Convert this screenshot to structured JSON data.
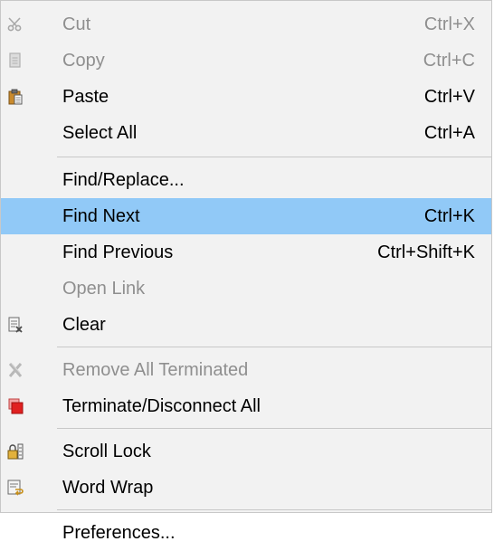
{
  "menu": {
    "items": [
      {
        "label": "Cut",
        "shortcut": "Ctrl+X",
        "icon": "scissors-icon",
        "disabled": true
      },
      {
        "label": "Copy",
        "shortcut": "Ctrl+C",
        "icon": "copy-icon",
        "disabled": true
      },
      {
        "label": "Paste",
        "shortcut": "Ctrl+V",
        "icon": "paste-icon",
        "disabled": false
      },
      {
        "label": "Select All",
        "shortcut": "Ctrl+A",
        "icon": "",
        "disabled": false
      },
      {
        "label": "Find/Replace...",
        "shortcut": "",
        "icon": "",
        "disabled": false
      },
      {
        "label": "Find Next",
        "shortcut": "Ctrl+K",
        "icon": "",
        "disabled": false,
        "selected": true
      },
      {
        "label": "Find Previous",
        "shortcut": "Ctrl+Shift+K",
        "icon": "",
        "disabled": false
      },
      {
        "label": "Open Link",
        "shortcut": "",
        "icon": "",
        "disabled": true
      },
      {
        "label": "Clear",
        "shortcut": "",
        "icon": "clear-console-icon",
        "disabled": false
      },
      {
        "label": "Remove All Terminated",
        "shortcut": "",
        "icon": "remove-all-terminated-icon",
        "disabled": true
      },
      {
        "label": "Terminate/Disconnect All",
        "shortcut": "",
        "icon": "terminate-icon",
        "disabled": false
      },
      {
        "label": "Scroll Lock",
        "shortcut": "",
        "icon": "scroll-lock-icon",
        "disabled": false
      },
      {
        "label": "Word Wrap",
        "shortcut": "",
        "icon": "word-wrap-icon",
        "disabled": false
      },
      {
        "label": "Preferences...",
        "shortcut": "",
        "icon": "",
        "disabled": false
      }
    ]
  },
  "colors": {
    "menu_bg": "#f2f2f2",
    "selected_bg": "#91c9f7",
    "disabled_text": "#8f8f8f",
    "separator": "#c8c8c8",
    "terminate_red": "#e02020"
  }
}
